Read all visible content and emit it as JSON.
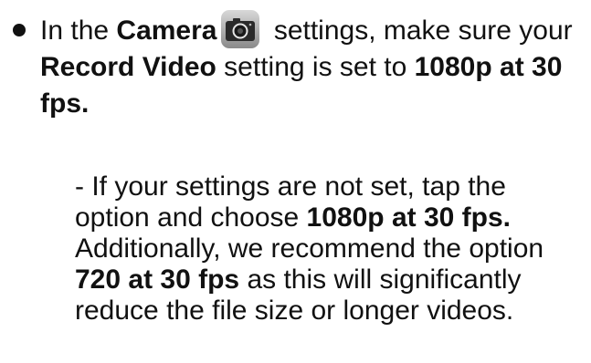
{
  "bullet": {
    "t1": "In the ",
    "camera": "Camera",
    "icon": "camera-app-icon",
    "t2": " settings, make sure your ",
    "record_video": "Record Video",
    "t3": " setting is set to ",
    "res1": "1080p at 30 fps."
  },
  "sub": {
    "t1": "- If your settings are not set, tap the option and choose ",
    "res1": "1080p at 30 fps.",
    "t2": " Additionally, we recommend the option ",
    "res2": "720 at 30 fps",
    "t3": " as this will significantly reduce the file size or longer videos."
  }
}
